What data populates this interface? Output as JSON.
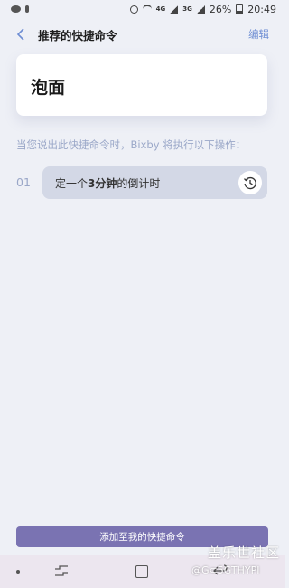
{
  "status_bar": {
    "network_4g": "4G",
    "network_3g": "3G",
    "battery": "26%",
    "time": "20:49"
  },
  "header": {
    "title": "推荐的快捷命令",
    "edit_label": "编辑"
  },
  "command": {
    "name": "泡面"
  },
  "description": "当您说出此快捷命令时，Bixby 将执行以下操作：",
  "actions": [
    {
      "index": "01",
      "text_prefix": "定一个",
      "text_bold": "3分钟",
      "text_suffix": "的倒计时",
      "icon": "timer-icon"
    }
  ],
  "add_button_label": "添加至我的快捷命令",
  "watermark": {
    "line1": "盖乐世社区",
    "line2": "@G⊂5GTHYPI"
  },
  "colors": {
    "accent": "#7a73b2",
    "edit": "#6d8dd3",
    "background": "#eef0f6",
    "pill": "#d3d8e6"
  }
}
